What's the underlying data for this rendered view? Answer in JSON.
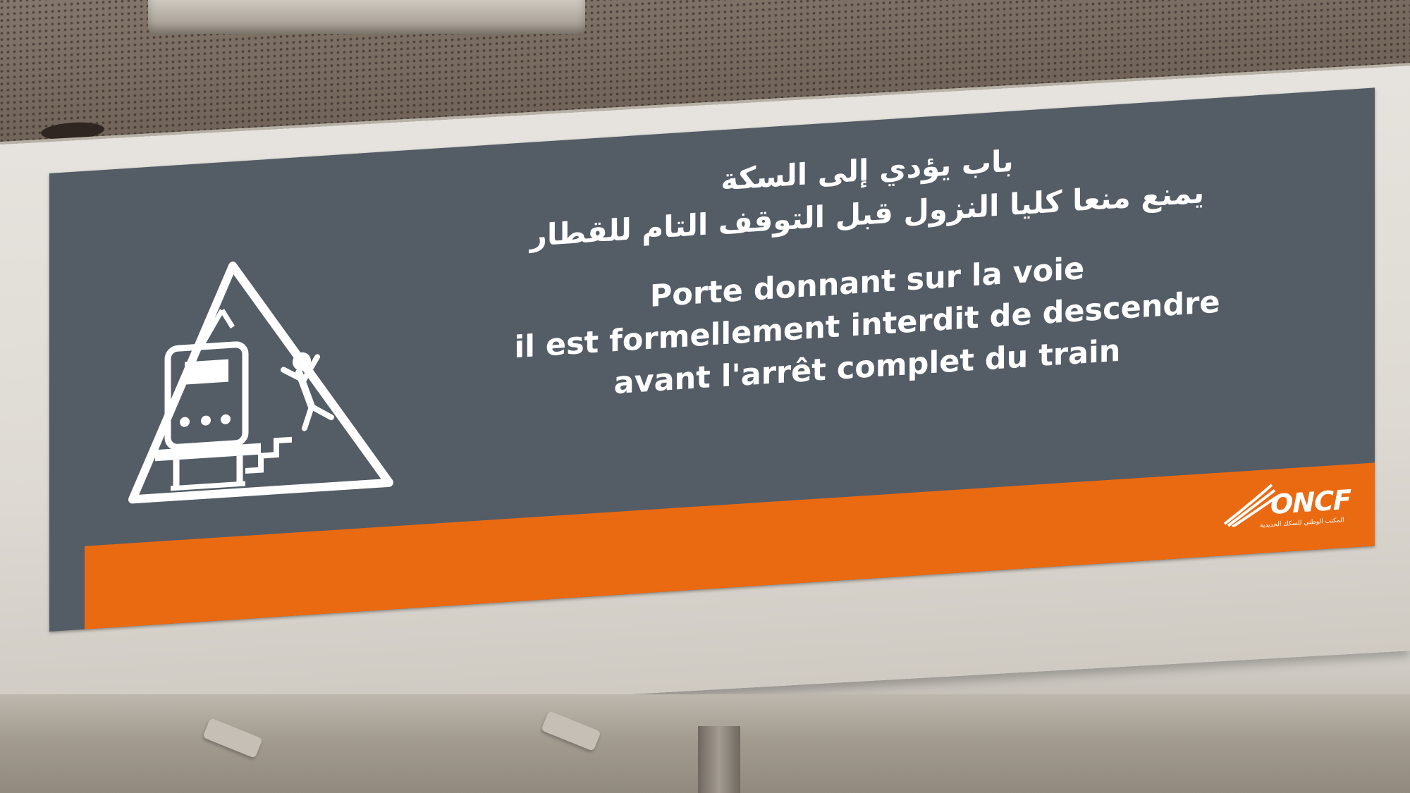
{
  "sign": {
    "arabic_lines": [
      "باب يؤدي إلى السكة",
      "يمنع منعا كليا النزول قبل التوقف التام للقطار"
    ],
    "french_lines": [
      "Porte donnant sur la voie",
      "il est formellement interdit de descendre",
      "avant l'arrêt complet du train"
    ],
    "logo": {
      "name": "ONCF",
      "subtitle": "المكتب الوطني للسكك الحديدية"
    },
    "pictogram": "train-door-fall-warning-icon",
    "colors": {
      "panel": "#545c66",
      "band": "#ea6a12",
      "text": "#ffffff"
    }
  }
}
